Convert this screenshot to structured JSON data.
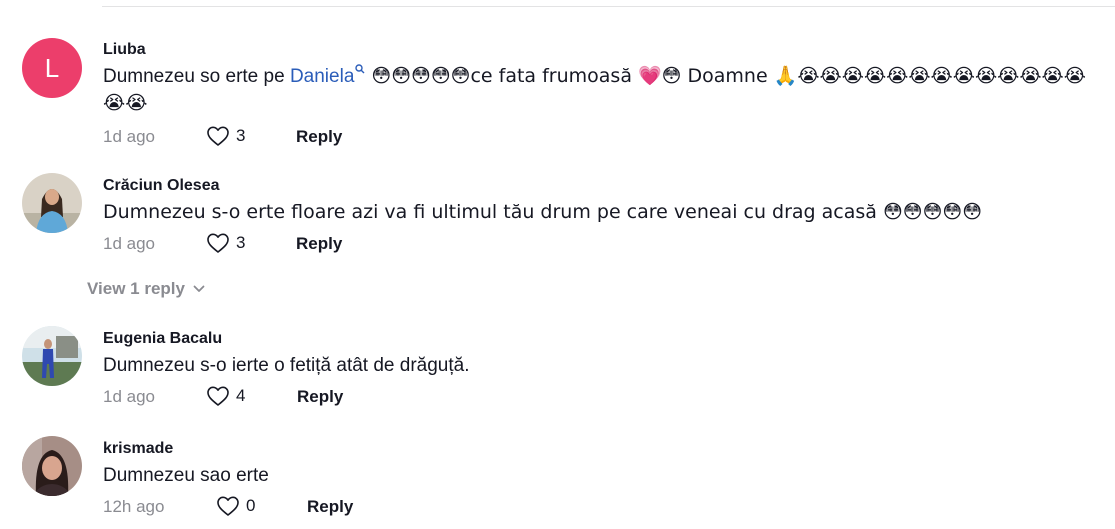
{
  "comments": [
    {
      "avatar_letter": "L",
      "username": "Liuba",
      "text_before": "Dumnezeu so erte pe ",
      "mention": "Daniela",
      "text_after": " 😳😳😳😳😳ce fata frumoasă 💗😳 Doamne 🙏😭😭😭😭😭😭😭😭😭😭😭😭😭😭😭",
      "time": "1d ago",
      "likes": "3",
      "reply_label": "Reply"
    },
    {
      "username": "Crăciun Olesea",
      "text": "Dumnezeu s-o erte floare azi va fi ultimul tău drum pe care veneai cu drag acasă 😳😳😳😳😳",
      "time": "1d ago",
      "likes": "3",
      "reply_label": "Reply"
    },
    {
      "username": "Eugenia Bacalu",
      "text": "Dumnezeu s-o ierte o fetiță atât de drăguță.",
      "time": "1d ago",
      "likes": "4",
      "reply_label": "Reply"
    },
    {
      "username": "krismade",
      "text": "Dumnezeu sao erte",
      "time": "12h ago",
      "likes": "0",
      "reply_label": "Reply"
    }
  ],
  "view_replies": "View 1 reply",
  "icons": {
    "like": "heart-outline-icon",
    "expand": "chevron-down-icon",
    "mention_search": "search-icon"
  },
  "colors": {
    "avatar_letter_bg": "#ec3e6b",
    "mention": "#2b5db9",
    "muted": "#8a8b91"
  }
}
